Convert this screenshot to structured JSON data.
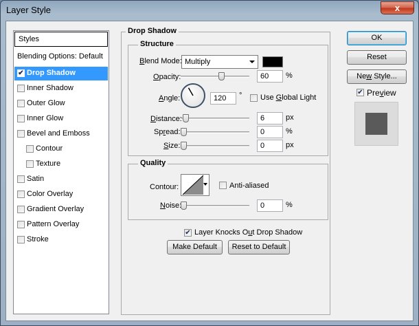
{
  "window": {
    "title": "Layer Style",
    "close_label": "x"
  },
  "sidebar": {
    "header": "Styles",
    "blending_options": "Blending Options: Default",
    "items": [
      {
        "label": "Drop Shadow",
        "checked": true,
        "active": true
      },
      {
        "label": "Inner Shadow",
        "checked": false
      },
      {
        "label": "Outer Glow",
        "checked": false
      },
      {
        "label": "Inner Glow",
        "checked": false
      },
      {
        "label": "Bevel and Emboss",
        "checked": false
      },
      {
        "label": "Contour",
        "checked": false,
        "sub": true
      },
      {
        "label": "Texture",
        "checked": false,
        "sub": true
      },
      {
        "label": "Satin",
        "checked": false
      },
      {
        "label": "Color Overlay",
        "checked": false
      },
      {
        "label": "Gradient Overlay",
        "checked": false
      },
      {
        "label": "Pattern Overlay",
        "checked": false
      },
      {
        "label": "Stroke",
        "checked": false
      }
    ]
  },
  "drop_shadow": {
    "group_title": "Drop Shadow",
    "structure": {
      "title": "Structure",
      "blend_mode": {
        "label_key": "B",
        "label_rest": "lend Mode:",
        "value": "Multiply"
      },
      "shadow_color": "#000000",
      "opacity": {
        "label_key": "O",
        "label_rest": "pacity:",
        "value": "60",
        "unit": "%",
        "level": 0.6
      },
      "angle": {
        "label_key": "A",
        "label_rest": "ngle:",
        "value": "120",
        "unit": "°",
        "degrees": 120
      },
      "use_global_light": {
        "label_pre": "Use ",
        "label_key": "G",
        "label_rest": "lobal Light",
        "checked": false
      },
      "distance": {
        "label_key": "D",
        "label_rest": "istance:",
        "value": "6",
        "unit": "px",
        "level": 0.03
      },
      "spread": {
        "label_pre": "Sp",
        "label_key": "r",
        "label_rest": "ead:",
        "value": "0",
        "unit": "%",
        "level": 0.0
      },
      "size": {
        "label_key": "S",
        "label_rest": "ize:",
        "value": "0",
        "unit": "px",
        "level": 0.0
      }
    },
    "quality": {
      "title": "Quality",
      "contour_label": "Contour:",
      "anti_aliased": {
        "label": "Anti-aliased",
        "checked": false
      },
      "noise": {
        "label_key": "N",
        "label_rest": "oise:",
        "value": "0",
        "unit": "%",
        "level": 0.0
      }
    },
    "knocks_out": {
      "label_pre": "Layer Knocks O",
      "label_key": "u",
      "label_rest": "t Drop Shadow",
      "checked": true
    },
    "make_default": "Make Default",
    "reset_to_default": "Reset to Default"
  },
  "buttons": {
    "ok": "OK",
    "reset": "Reset",
    "new_style_pre": "Ne",
    "new_style_key": "w",
    "new_style_rest": " Style..."
  },
  "preview": {
    "label_pre": "Pre",
    "label_key": "v",
    "label_rest": "iew",
    "checked": true
  }
}
